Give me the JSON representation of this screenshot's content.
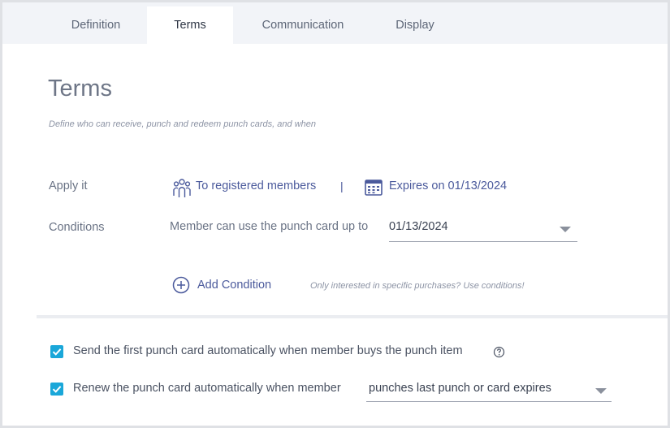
{
  "tabs": [
    {
      "label": "Definition"
    },
    {
      "label": "Terms"
    },
    {
      "label": "Communication"
    },
    {
      "label": "Display"
    }
  ],
  "active_tab": "Terms",
  "page": {
    "title": "Terms",
    "subtitle": "Define who can receive, punch and redeem punch cards, and when"
  },
  "apply": {
    "label": "Apply it",
    "members_link": "To registered members",
    "members_icon": "members-icon",
    "separator": "|",
    "expires_link": "Expires on 01/13/2024",
    "expires_icon": "calendar-icon"
  },
  "conditions": {
    "label": "Conditions",
    "rule_text": "Member can use the punch card up to",
    "date_value": "01/13/2024",
    "add_label": "Add Condition",
    "add_icon": "plus-circle-icon",
    "hint": "Only interested in specific purchases? Use conditions!"
  },
  "options": {
    "send_first": {
      "label": "Send the first punch card automatically when member buys the punch item",
      "checked": true
    },
    "renew": {
      "label": "Renew the punch card automatically when member",
      "checked": true,
      "value": "punches last punch or card expires"
    }
  },
  "colors": {
    "accent": "#1aa7d9",
    "link": "#4b5a9c",
    "tab_bar": "#f2f4f8"
  }
}
